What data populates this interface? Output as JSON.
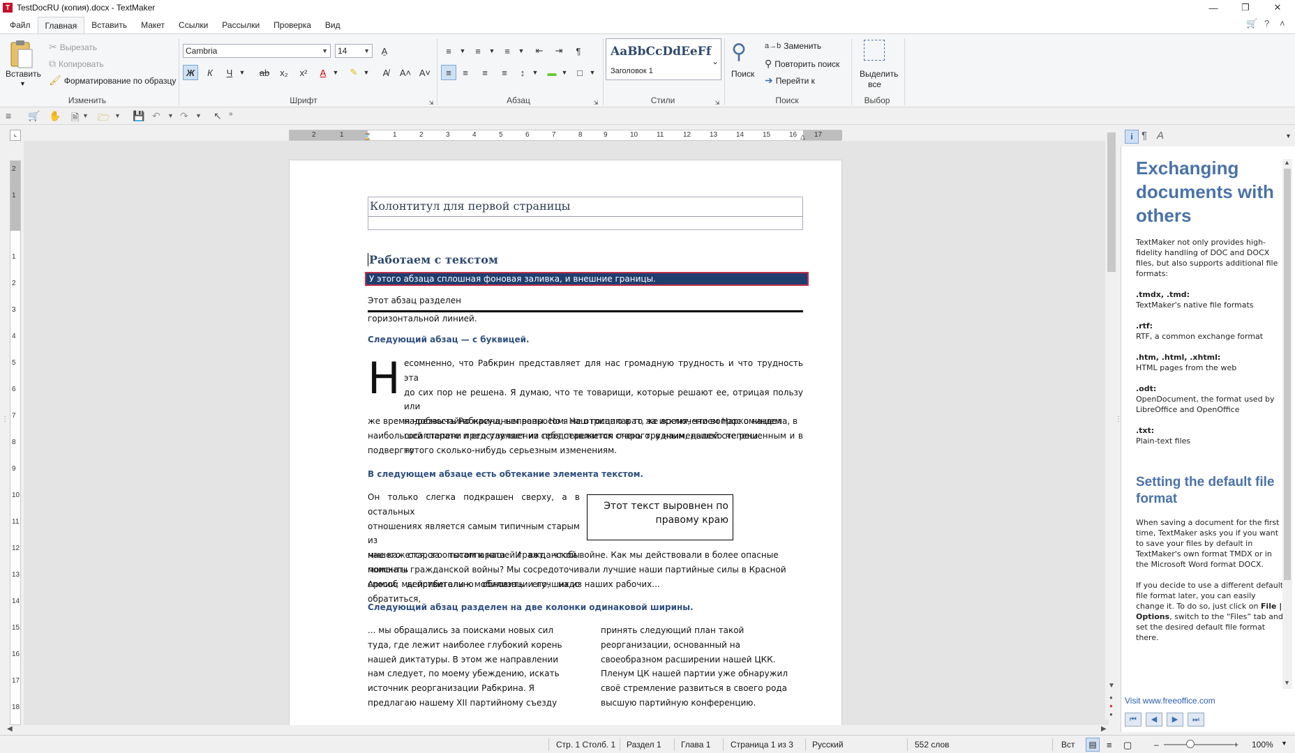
{
  "window": {
    "title": "TestDocRU (копия).docx - TextMaker",
    "app_icon": "T"
  },
  "menu": [
    "Файл",
    "Главная",
    "Вставить",
    "Макет",
    "Ссылки",
    "Рассылки",
    "Проверка",
    "Вид"
  ],
  "ribbon": {
    "edit": {
      "paste": "Вставить",
      "cut": "Вырезать",
      "copy": "Копировать",
      "format_painter": "Форматирование по образцу",
      "label": "Изменить"
    },
    "font": {
      "name": "Cambria",
      "size": "14",
      "label": "Шрифт",
      "bold": "Ж",
      "italic": "К",
      "underline": "Ч"
    },
    "paragraph": {
      "label": "Абзац"
    },
    "styles": {
      "preview": "AaBbCcDdEeFf",
      "current": "Заголовок 1",
      "label": "Стили"
    },
    "search": {
      "search": "Поиск",
      "replace": "Заменить",
      "repeat": "Повторить поиск",
      "goto": "Перейти к",
      "label": "Поиск"
    },
    "select": {
      "select_all_line1": "Выделить",
      "select_all_line2": "все",
      "label": "Выбор"
    }
  },
  "ruler": {
    "h_numbers": [
      "2",
      "1",
      "1",
      "2",
      "3",
      "4",
      "5",
      "6",
      "7",
      "8",
      "9",
      "10",
      "11",
      "12",
      "13",
      "14",
      "15",
      "16",
      "17"
    ],
    "v_numbers": [
      "2",
      "1",
      "1",
      "2",
      "3",
      "4",
      "5",
      "6",
      "7",
      "8",
      "9",
      "10",
      "11",
      "12",
      "13",
      "14",
      "15",
      "16",
      "17",
      "18"
    ]
  },
  "document": {
    "header_text": "Колонтитул для первой страницы",
    "h1": "Работаем с текстом",
    "shaded_para": "У этого абзаца сплошная фоновая заливка, и внешние границы.",
    "rule_para_1": "Этот абзац разделен",
    "rule_para_2": "горизонтальной линией.",
    "dropcap_heading": "Следующий абзац — с буквицей.",
    "dropcap_letter": "Н",
    "dropcap_lines": [
      "есомненно, что Рабкрин представляет для нас громадную трудность и что трудность эта",
      "до сих пор не решена. Я думаю, что те товарищи, которые решают ее, отрицая пользу или",
      "надобность Рабкрина, неправы. Но я не отрицаю в то же время, что вопрос о нашем",
      "госаппарате и его улучшении представляется очень трудным, далеко не решенным и в то"
    ],
    "dropcap_rest": [
      "же время чрезвычайно насущным вопросом. Наш госаппарат, за исключением Наркоминдела, в",
      "наибольшей степени представляет из себя пережиток старого, в наименьшей степени",
      "подвергнутого сколько-нибудь серьезным изменениям."
    ],
    "wrap_heading": "В следующем абзаце есть обтекание элемента текстом.",
    "wrap_lines": [
      "Он только слегка подкрашен сверху, а в остальных",
      "отношениях является самым типичным старым из",
      "нашего старого госаппарата. И вот, чтобы поискать",
      "способ действительно обновить его, надо обратиться,"
    ],
    "wrap_rest": [
      "мне кажется, за опытом к нашей гражданской войне. Как мы действовали в более опасные",
      "моменты гражданской войны? Мы сосредоточивали лучшие наши партийные силы в Красной",
      "Армии; мы прибегали к мобилизации лучших из наших рабочих..."
    ],
    "framed_text": "Этот текст выровнен по правому краю",
    "columns_heading": "Следующий абзац разделен на две колонки одинаковой ширины.",
    "col1": [
      "... мы обращались за поисками новых сил",
      "туда, где лежит наиболее глубокий корень",
      "нашей диктатуры. В этом же направлении",
      "нам следует, по моему убеждению, искать",
      "источник реорганизации Рабкрина. Я",
      "предлагаю нашему XII партийному съезду"
    ],
    "col2": [
      "принять следующий план такой",
      "реорганизации, основанный на",
      "своеобразном расширении нашей ЦКК.",
      "Пленум ЦК нашей партии уже обнаружил",
      "своё стремление развиться в своего рода",
      "высшую партийную конференцию."
    ]
  },
  "sidebar": {
    "h1": "Exchanging documents with others",
    "intro": "TextMaker not only provides high-fidelity handling of DOC and DOCX files, but also supports additional file formats:",
    "formats": [
      {
        "ext": ".tmdx, .tmd:",
        "desc": "TextMaker's native file formats"
      },
      {
        "ext": ".rtf:",
        "desc": "RTF, a common exchange format"
      },
      {
        "ext": ".htm, .html, .xhtml:",
        "desc": "HTML pages from the web"
      },
      {
        "ext": ".odt:",
        "desc": "OpenDocument, the format used by LibreOffice and OpenOffice"
      },
      {
        "ext": ".txt:",
        "desc": "Plain-text files"
      }
    ],
    "h2": "Setting the default file format",
    "p2": "When saving a document for the first time, TextMaker asks you if you want to save your files by default in TextMaker's own format TMDX or in the Microsoft Word format DOCX.",
    "p3a": "If you decide to use a different default file format later, you can easily change it. To do so, just click on ",
    "p3b": "File | Options",
    "p3c": ", switch to the “Files” tab and set the desired default file format there.",
    "link": "Visit www.freeoffice.com"
  },
  "status": {
    "position": "Стр. 1 Столб. 1",
    "section": "Раздел 1",
    "chapter": "Глава 1",
    "page": "Страница 1 из 3",
    "language": "Русский",
    "words": "552 слов",
    "mode": "Вст",
    "zoom": "100%"
  },
  "colors": {
    "accent": "#2f4a6e",
    "shaded_fill": "#1f3e6e",
    "shaded_border": "#c0304a",
    "sidebar_heading": "#4a72a8"
  }
}
